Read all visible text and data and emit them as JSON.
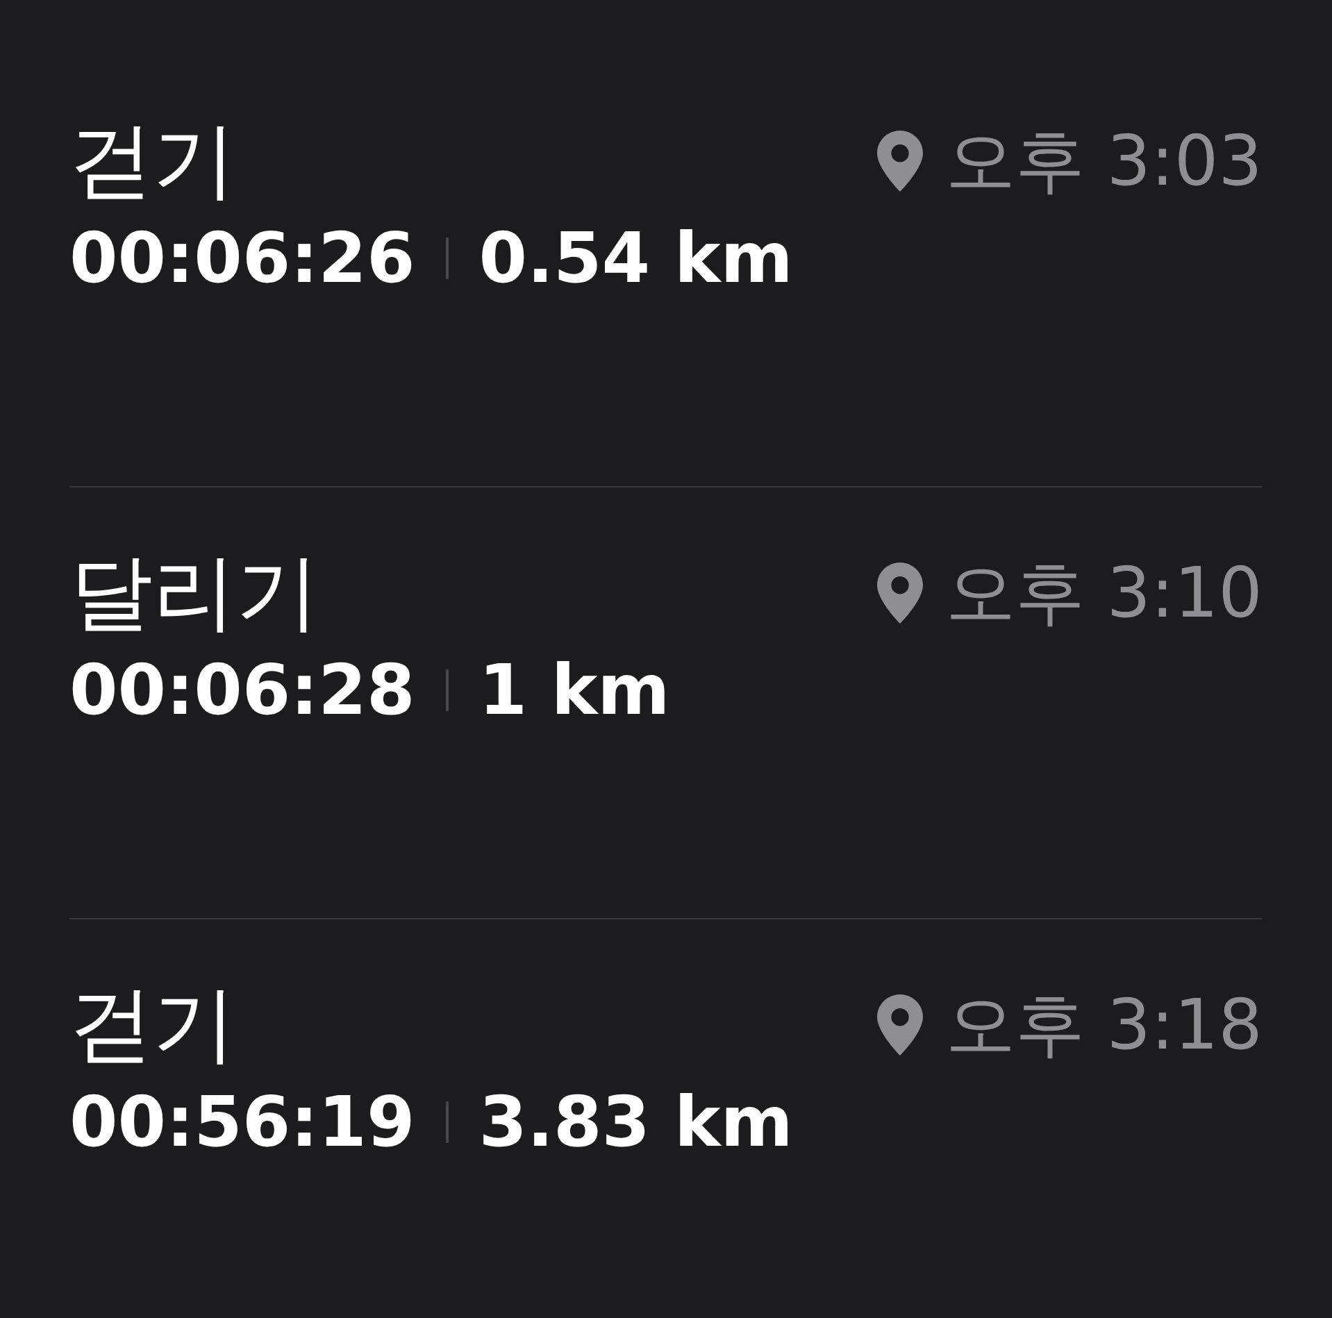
{
  "records": [
    {
      "title": "걷기",
      "time": "오후 3:03",
      "duration": "00:06:26",
      "distance": "0.54 km"
    },
    {
      "title": "달리기",
      "time": "오후 3:10",
      "duration": "00:06:28",
      "distance": "1 km"
    },
    {
      "title": "걷기",
      "time": "오후 3:18",
      "duration": "00:56:19",
      "distance": "3.83 km"
    }
  ]
}
